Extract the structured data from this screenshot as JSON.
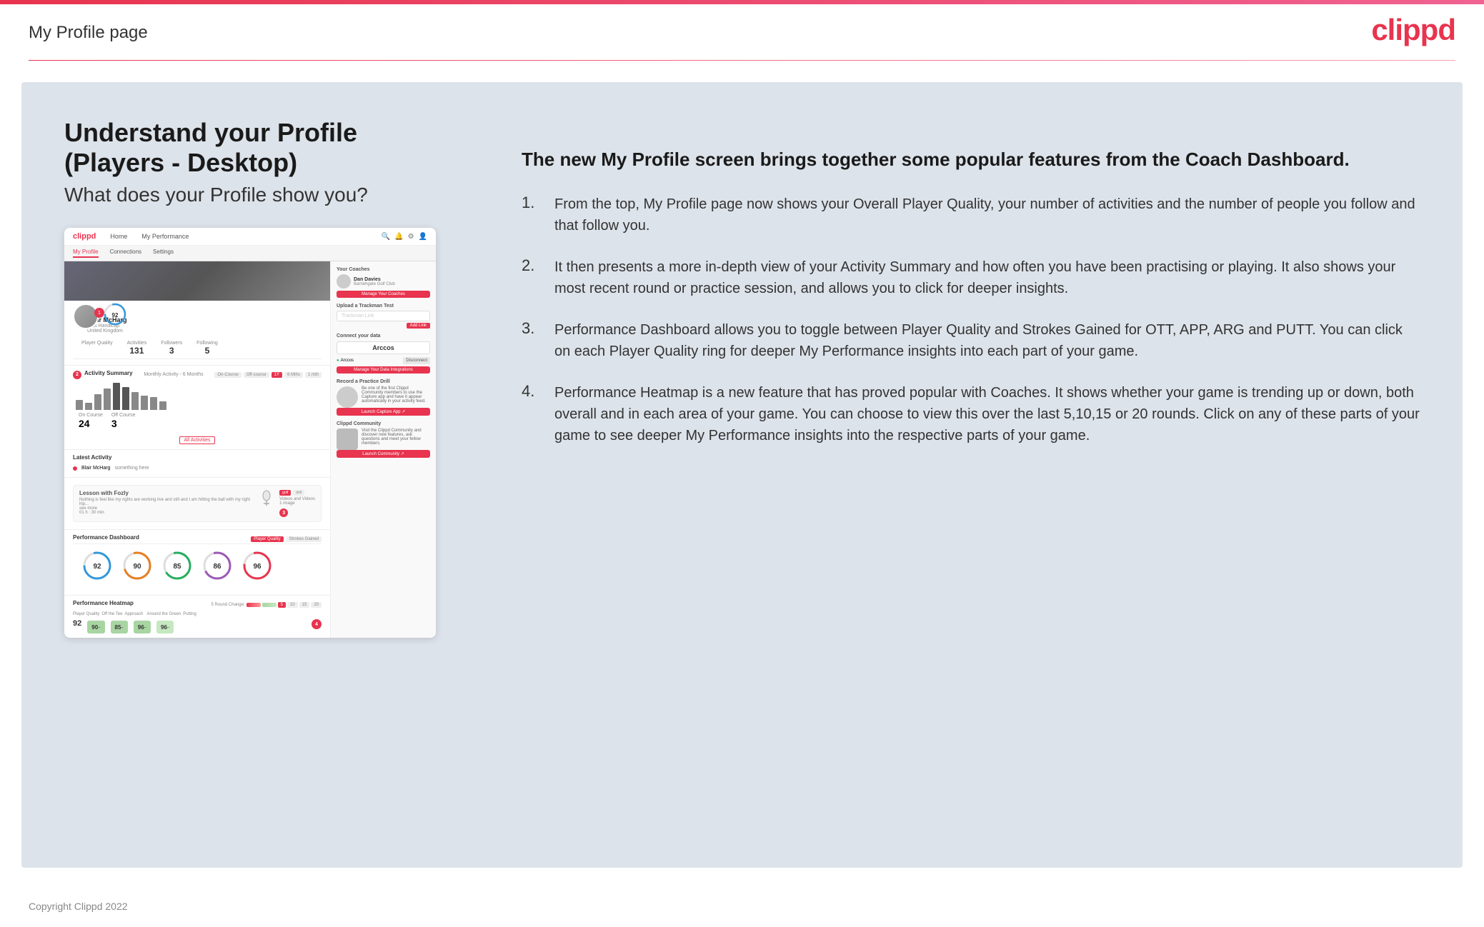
{
  "header": {
    "page_title": "My Profile page",
    "logo": "clippd"
  },
  "main": {
    "heading": "Understand your Profile (Players - Desktop)",
    "subheading": "What does your Profile show you?",
    "highlight": "The new My Profile screen brings together some popular features from the Coach Dashboard.",
    "list_items": [
      {
        "number": "1.",
        "text": "From the top, My Profile page now shows your Overall Player Quality, your number of activities and the number of people you follow and that follow you."
      },
      {
        "number": "2.",
        "text": "It then presents a more in-depth view of your Activity Summary and how often you have been practising or playing. It also shows your most recent round or practice session, and allows you to click for deeper insights."
      },
      {
        "number": "3.",
        "text": "Performance Dashboard allows you to toggle between Player Quality and Strokes Gained for OTT, APP, ARG and PUTT. You can click on each Player Quality ring for deeper My Performance insights into each part of your game."
      },
      {
        "number": "4.",
        "text": "Performance Heatmap is a new feature that has proved popular with Coaches. It shows whether your game is trending up or down, both overall and in each area of your game. You can choose to view this over the last 5,10,15 or 20 rounds. Click on any of these parts of your game to see deeper My Performance insights into the respective parts of your game."
      }
    ]
  },
  "mockup": {
    "nav": {
      "logo": "clippd",
      "items": [
        "Home",
        "My Performance"
      ],
      "subnav": [
        "My Profile",
        "Connections",
        "Settings"
      ]
    },
    "profile": {
      "name": "Blair McHarg",
      "handicap": "Plus Handicap",
      "location": "United Kingdom",
      "quality": "92",
      "activities": "131",
      "followers": "3",
      "following": "5"
    },
    "activity": {
      "title": "Activity Summary",
      "subtitle": "Monthly Activity - 6 Months",
      "on_course": "24",
      "off_course": "3",
      "bars": [
        35,
        20,
        28,
        45,
        55,
        62,
        48,
        30,
        22,
        18
      ]
    },
    "performance": {
      "title": "Performance Dashboard",
      "overall": "92",
      "off_tee": "90",
      "approach": "85",
      "around_green": "86",
      "putting": "96"
    },
    "heatmap": {
      "title": "Performance Heatmap",
      "overall": "92",
      "off_tee": "90",
      "approach": "85",
      "around_green": "96",
      "putting": "96"
    },
    "right_panel": {
      "coaches_title": "Your Coaches",
      "coach_name": "Dan Davies",
      "coach_club": "Barnehgate Golf Club",
      "coach_btn": "Manage Your Coaches",
      "trackman_title": "Upload a Trackman Test",
      "trackman_placeholder": "Trackman Link",
      "connect_title": "Connect your data",
      "arccos": "Arccos",
      "practice_title": "Record a Practice Drill",
      "community_title": "Clippd Community"
    }
  },
  "footer": {
    "copyright": "Copyright Clippd 2022"
  }
}
